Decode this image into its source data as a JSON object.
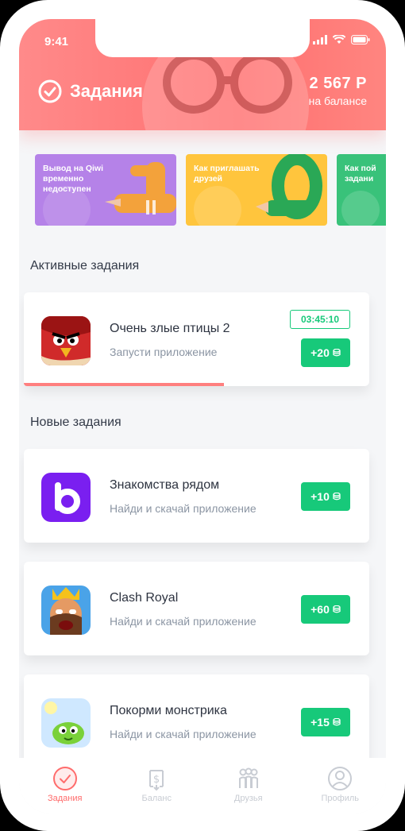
{
  "status": {
    "time": "9:41"
  },
  "header": {
    "title": "Задания",
    "balance_amount": "2 567 Р",
    "balance_label": "на балансе"
  },
  "stories": [
    {
      "text": "Вывод на Qiwi временно недоступен",
      "color": "#b582e8"
    },
    {
      "text": "Как приглашать друзей",
      "color": "#ffc53d"
    },
    {
      "text": "Как пой задани",
      "color": "#39c27a"
    }
  ],
  "sections": {
    "active": "Активные задания",
    "new": "Новые задания"
  },
  "active_task": {
    "name": "Очень злые птицы 2",
    "desc": "Запусти приложение",
    "timer": "03:45:10",
    "reward": "+20",
    "progress": 0.58
  },
  "new_tasks": [
    {
      "name": "Знакомства рядом",
      "desc": "Найди и скачай приложение",
      "reward": "+10"
    },
    {
      "name": "Clash Royal",
      "desc": "Найди и скачай приложение",
      "reward": "+60"
    },
    {
      "name": "Покорми монстрика",
      "desc": "Найди и скачай приложение",
      "reward": "+15"
    }
  ],
  "tabs": [
    {
      "label": "Задания",
      "icon": "check-circle-icon",
      "active": true
    },
    {
      "label": "Баланс",
      "icon": "wallet-icon",
      "active": false
    },
    {
      "label": "Друзья",
      "icon": "friends-icon",
      "active": false
    },
    {
      "label": "Профиль",
      "icon": "profile-icon",
      "active": false
    }
  ],
  "colors": {
    "accent": "#ff7474",
    "reward": "#17c97a",
    "text": "#2d3340",
    "muted": "#8b95a3"
  }
}
